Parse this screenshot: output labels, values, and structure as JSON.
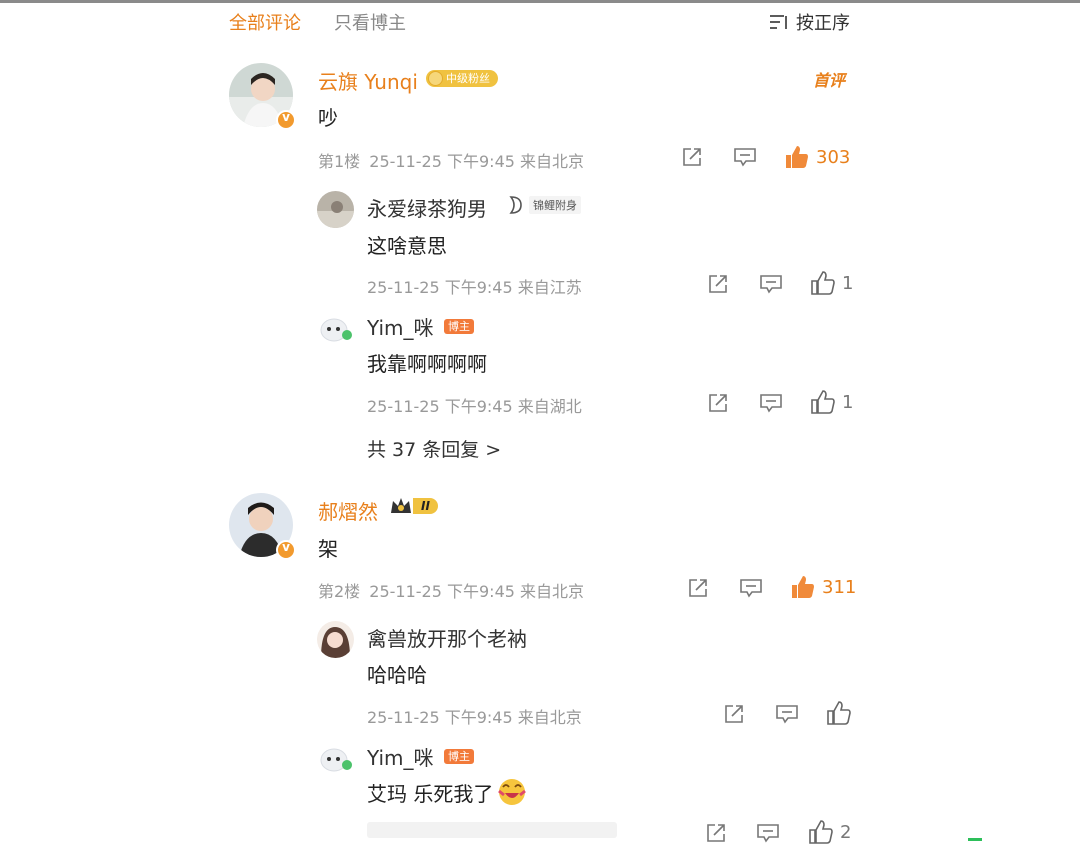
{
  "tabs": {
    "all": "全部评论",
    "blogger_only": "只看博主"
  },
  "sort": {
    "label": "按正序"
  },
  "threads": [
    {
      "name": "云旗 Yunqi",
      "badge": "中级粉丝",
      "label_right": "首评",
      "text": "吵",
      "floor": "第1楼",
      "time": "25-11-25 下午9:45 来自北京",
      "likes": "303",
      "replies": [
        {
          "name": "永爱绿茶狗男",
          "badge": "锦鲤附身",
          "text": "这啥意思",
          "time": "25-11-25 下午9:45 来自江苏",
          "likes": "1"
        },
        {
          "name": "Yim_咪",
          "badge": "博主",
          "text": "我靠啊啊啊啊",
          "time": "25-11-25 下午9:45 来自湖北",
          "likes": "1"
        }
      ],
      "more_replies": "共 37 条回复 >"
    },
    {
      "name": "郝熠然",
      "badge": "II",
      "text": "架",
      "floor": "第2楼",
      "time": "25-11-25 下午9:45 来自北京",
      "likes": "311",
      "replies": [
        {
          "name": "禽兽放开那个老衲",
          "text": "哈哈哈",
          "time": "25-11-25 下午9:45 来自北京",
          "likes": ""
        },
        {
          "name": "Yim_咪",
          "badge": "博主",
          "text": "艾玛 乐死我了",
          "likes": "2"
        }
      ]
    }
  ],
  "colors": {
    "accent": "#e8801c",
    "meta": "#999999",
    "blogger_tag": "#f27a3a"
  },
  "icons": [
    "sort-icon",
    "share-icon",
    "comment-icon",
    "like-icon",
    "verified-icon",
    "crown-icon",
    "fish-icon",
    "laugh-emoji-icon"
  ]
}
